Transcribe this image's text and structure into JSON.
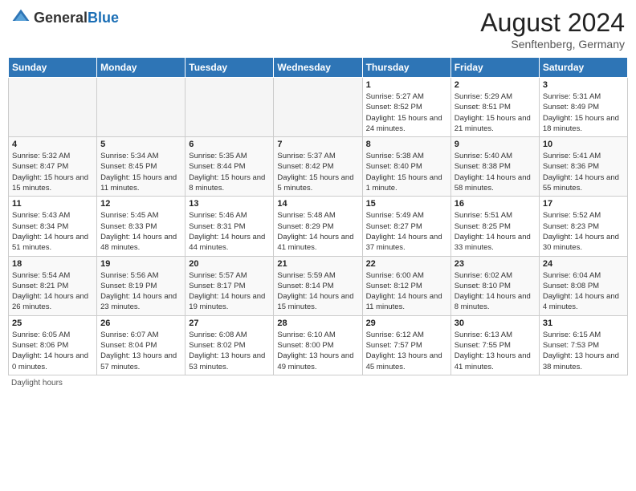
{
  "header": {
    "logo_general": "General",
    "logo_blue": "Blue",
    "month_year": "August 2024",
    "location": "Senftenberg, Germany"
  },
  "days_of_week": [
    "Sunday",
    "Monday",
    "Tuesday",
    "Wednesday",
    "Thursday",
    "Friday",
    "Saturday"
  ],
  "footer": {
    "daylight_hours": "Daylight hours"
  },
  "weeks": [
    [
      {
        "day": "",
        "sunrise": "",
        "sunset": "",
        "daylight": "",
        "empty": true
      },
      {
        "day": "",
        "sunrise": "",
        "sunset": "",
        "daylight": "",
        "empty": true
      },
      {
        "day": "",
        "sunrise": "",
        "sunset": "",
        "daylight": "",
        "empty": true
      },
      {
        "day": "",
        "sunrise": "",
        "sunset": "",
        "daylight": "",
        "empty": true
      },
      {
        "day": "1",
        "sunrise": "Sunrise: 5:27 AM",
        "sunset": "Sunset: 8:52 PM",
        "daylight": "Daylight: 15 hours and 24 minutes.",
        "empty": false
      },
      {
        "day": "2",
        "sunrise": "Sunrise: 5:29 AM",
        "sunset": "Sunset: 8:51 PM",
        "daylight": "Daylight: 15 hours and 21 minutes.",
        "empty": false
      },
      {
        "day": "3",
        "sunrise": "Sunrise: 5:31 AM",
        "sunset": "Sunset: 8:49 PM",
        "daylight": "Daylight: 15 hours and 18 minutes.",
        "empty": false
      }
    ],
    [
      {
        "day": "4",
        "sunrise": "Sunrise: 5:32 AM",
        "sunset": "Sunset: 8:47 PM",
        "daylight": "Daylight: 15 hours and 15 minutes.",
        "empty": false
      },
      {
        "day": "5",
        "sunrise": "Sunrise: 5:34 AM",
        "sunset": "Sunset: 8:45 PM",
        "daylight": "Daylight: 15 hours and 11 minutes.",
        "empty": false
      },
      {
        "day": "6",
        "sunrise": "Sunrise: 5:35 AM",
        "sunset": "Sunset: 8:44 PM",
        "daylight": "Daylight: 15 hours and 8 minutes.",
        "empty": false
      },
      {
        "day": "7",
        "sunrise": "Sunrise: 5:37 AM",
        "sunset": "Sunset: 8:42 PM",
        "daylight": "Daylight: 15 hours and 5 minutes.",
        "empty": false
      },
      {
        "day": "8",
        "sunrise": "Sunrise: 5:38 AM",
        "sunset": "Sunset: 8:40 PM",
        "daylight": "Daylight: 15 hours and 1 minute.",
        "empty": false
      },
      {
        "day": "9",
        "sunrise": "Sunrise: 5:40 AM",
        "sunset": "Sunset: 8:38 PM",
        "daylight": "Daylight: 14 hours and 58 minutes.",
        "empty": false
      },
      {
        "day": "10",
        "sunrise": "Sunrise: 5:41 AM",
        "sunset": "Sunset: 8:36 PM",
        "daylight": "Daylight: 14 hours and 55 minutes.",
        "empty": false
      }
    ],
    [
      {
        "day": "11",
        "sunrise": "Sunrise: 5:43 AM",
        "sunset": "Sunset: 8:34 PM",
        "daylight": "Daylight: 14 hours and 51 minutes.",
        "empty": false
      },
      {
        "day": "12",
        "sunrise": "Sunrise: 5:45 AM",
        "sunset": "Sunset: 8:33 PM",
        "daylight": "Daylight: 14 hours and 48 minutes.",
        "empty": false
      },
      {
        "day": "13",
        "sunrise": "Sunrise: 5:46 AM",
        "sunset": "Sunset: 8:31 PM",
        "daylight": "Daylight: 14 hours and 44 minutes.",
        "empty": false
      },
      {
        "day": "14",
        "sunrise": "Sunrise: 5:48 AM",
        "sunset": "Sunset: 8:29 PM",
        "daylight": "Daylight: 14 hours and 41 minutes.",
        "empty": false
      },
      {
        "day": "15",
        "sunrise": "Sunrise: 5:49 AM",
        "sunset": "Sunset: 8:27 PM",
        "daylight": "Daylight: 14 hours and 37 minutes.",
        "empty": false
      },
      {
        "day": "16",
        "sunrise": "Sunrise: 5:51 AM",
        "sunset": "Sunset: 8:25 PM",
        "daylight": "Daylight: 14 hours and 33 minutes.",
        "empty": false
      },
      {
        "day": "17",
        "sunrise": "Sunrise: 5:52 AM",
        "sunset": "Sunset: 8:23 PM",
        "daylight": "Daylight: 14 hours and 30 minutes.",
        "empty": false
      }
    ],
    [
      {
        "day": "18",
        "sunrise": "Sunrise: 5:54 AM",
        "sunset": "Sunset: 8:21 PM",
        "daylight": "Daylight: 14 hours and 26 minutes.",
        "empty": false
      },
      {
        "day": "19",
        "sunrise": "Sunrise: 5:56 AM",
        "sunset": "Sunset: 8:19 PM",
        "daylight": "Daylight: 14 hours and 23 minutes.",
        "empty": false
      },
      {
        "day": "20",
        "sunrise": "Sunrise: 5:57 AM",
        "sunset": "Sunset: 8:17 PM",
        "daylight": "Daylight: 14 hours and 19 minutes.",
        "empty": false
      },
      {
        "day": "21",
        "sunrise": "Sunrise: 5:59 AM",
        "sunset": "Sunset: 8:14 PM",
        "daylight": "Daylight: 14 hours and 15 minutes.",
        "empty": false
      },
      {
        "day": "22",
        "sunrise": "Sunrise: 6:00 AM",
        "sunset": "Sunset: 8:12 PM",
        "daylight": "Daylight: 14 hours and 11 minutes.",
        "empty": false
      },
      {
        "day": "23",
        "sunrise": "Sunrise: 6:02 AM",
        "sunset": "Sunset: 8:10 PM",
        "daylight": "Daylight: 14 hours and 8 minutes.",
        "empty": false
      },
      {
        "day": "24",
        "sunrise": "Sunrise: 6:04 AM",
        "sunset": "Sunset: 8:08 PM",
        "daylight": "Daylight: 14 hours and 4 minutes.",
        "empty": false
      }
    ],
    [
      {
        "day": "25",
        "sunrise": "Sunrise: 6:05 AM",
        "sunset": "Sunset: 8:06 PM",
        "daylight": "Daylight: 14 hours and 0 minutes.",
        "empty": false
      },
      {
        "day": "26",
        "sunrise": "Sunrise: 6:07 AM",
        "sunset": "Sunset: 8:04 PM",
        "daylight": "Daylight: 13 hours and 57 minutes.",
        "empty": false
      },
      {
        "day": "27",
        "sunrise": "Sunrise: 6:08 AM",
        "sunset": "Sunset: 8:02 PM",
        "daylight": "Daylight: 13 hours and 53 minutes.",
        "empty": false
      },
      {
        "day": "28",
        "sunrise": "Sunrise: 6:10 AM",
        "sunset": "Sunset: 8:00 PM",
        "daylight": "Daylight: 13 hours and 49 minutes.",
        "empty": false
      },
      {
        "day": "29",
        "sunrise": "Sunrise: 6:12 AM",
        "sunset": "Sunset: 7:57 PM",
        "daylight": "Daylight: 13 hours and 45 minutes.",
        "empty": false
      },
      {
        "day": "30",
        "sunrise": "Sunrise: 6:13 AM",
        "sunset": "Sunset: 7:55 PM",
        "daylight": "Daylight: 13 hours and 41 minutes.",
        "empty": false
      },
      {
        "day": "31",
        "sunrise": "Sunrise: 6:15 AM",
        "sunset": "Sunset: 7:53 PM",
        "daylight": "Daylight: 13 hours and 38 minutes.",
        "empty": false
      }
    ]
  ]
}
